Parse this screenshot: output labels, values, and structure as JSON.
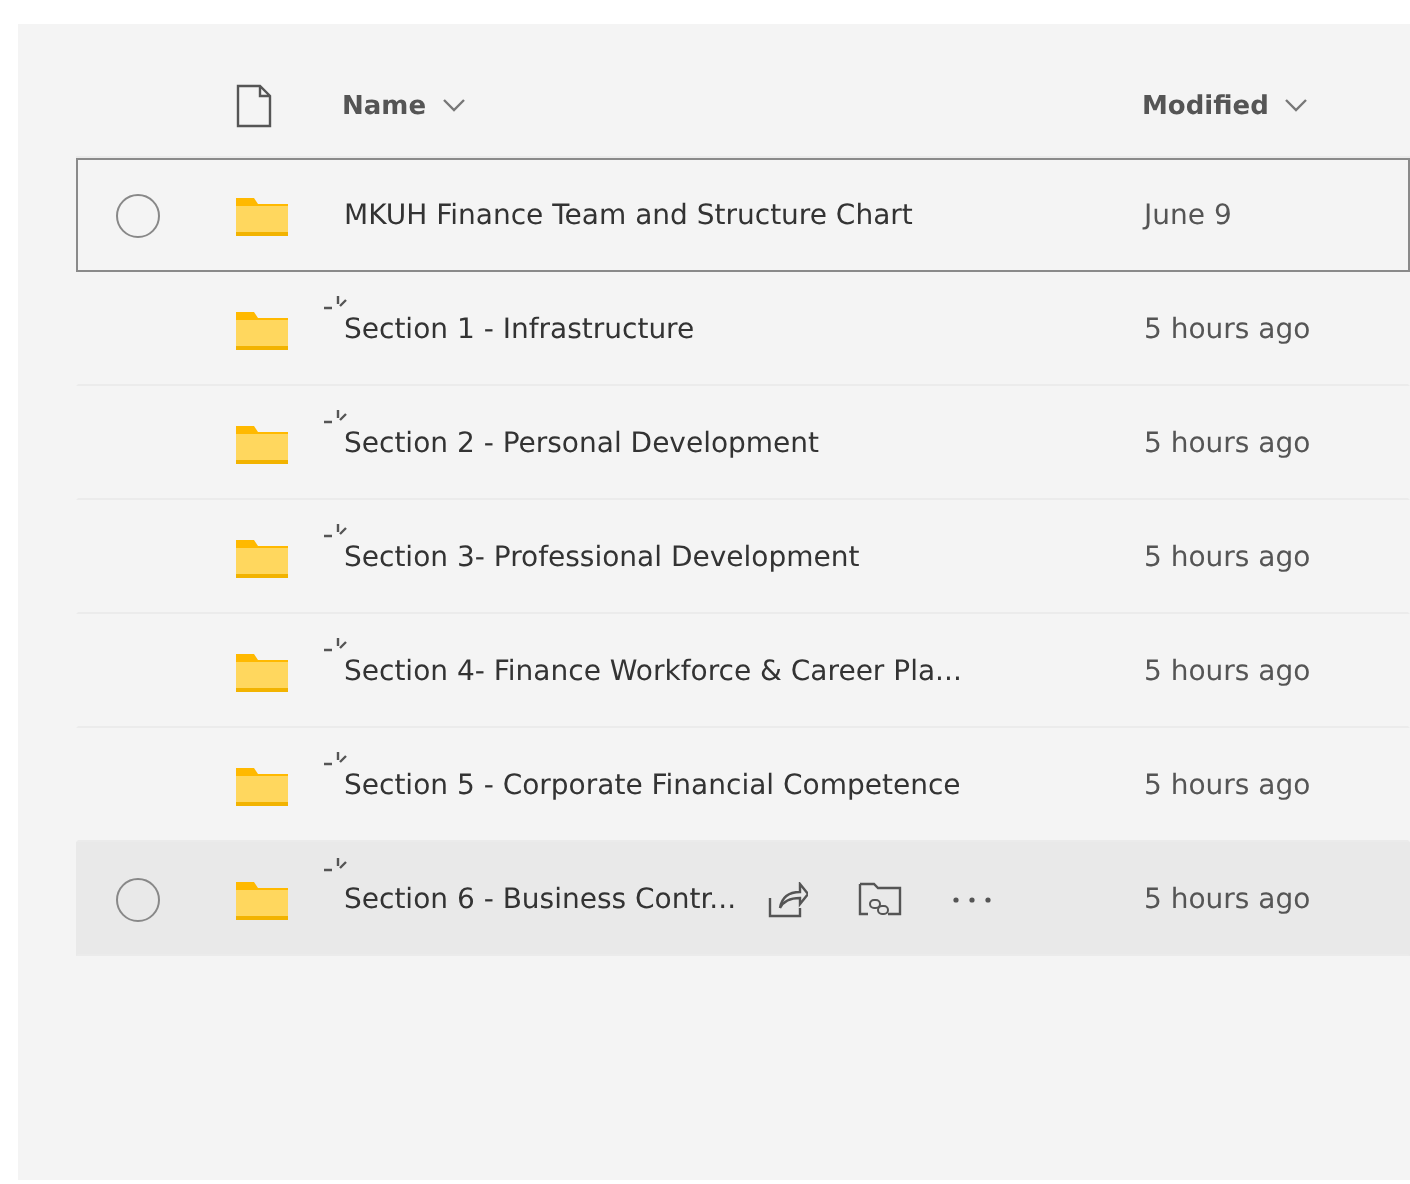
{
  "columns": [
    {
      "label": "Name"
    },
    {
      "label": "Modified"
    }
  ],
  "rows": [
    {
      "name": "MKUH Finance Team and Structure Chart",
      "modified": "June 9",
      "focused": true,
      "hovered": false,
      "new": false
    },
    {
      "name": "Section 1 - Infrastructure",
      "modified": "5 hours ago",
      "focused": false,
      "hovered": false,
      "new": true
    },
    {
      "name": "Section 2 - Personal Development",
      "modified": "5 hours ago",
      "focused": false,
      "hovered": false,
      "new": true
    },
    {
      "name": "Section 3- Professional Development",
      "modified": "5 hours ago",
      "focused": false,
      "hovered": false,
      "new": true
    },
    {
      "name": "Section 4- Finance Workforce & Career Pla...",
      "modified": "5 hours ago",
      "focused": false,
      "hovered": false,
      "new": true
    },
    {
      "name": "Section 5 - Corporate Financial Competence",
      "modified": "5 hours ago",
      "focused": false,
      "hovered": false,
      "new": true
    },
    {
      "name": "Section 6 - Business Contr...",
      "modified": "5 hours ago",
      "focused": false,
      "hovered": true,
      "new": true
    }
  ]
}
